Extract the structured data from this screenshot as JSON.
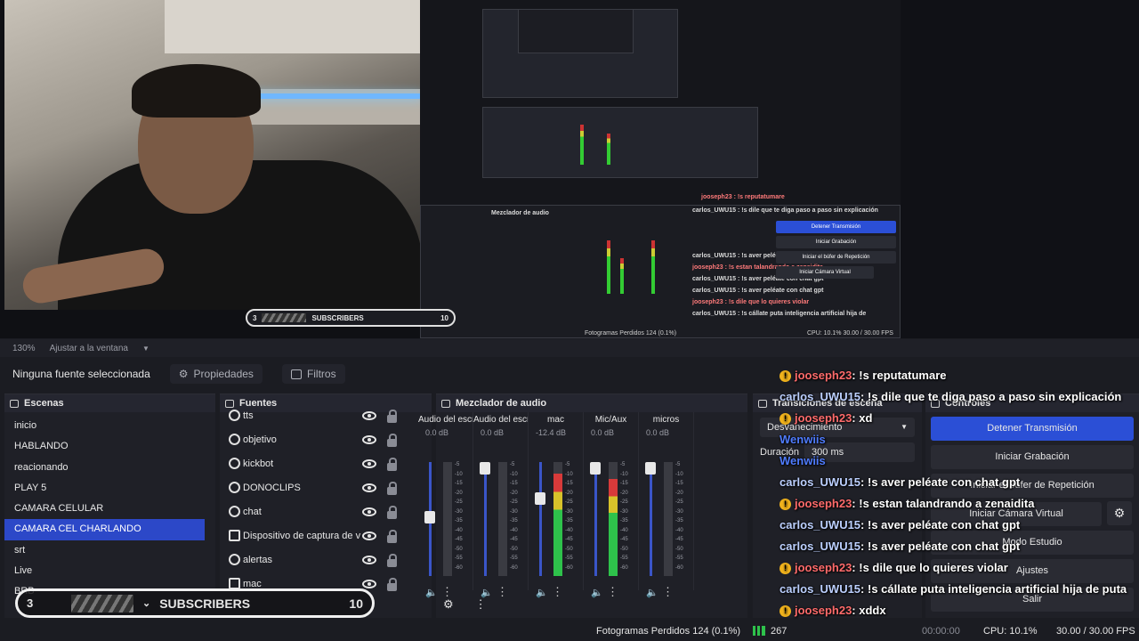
{
  "zoom": {
    "level": "130%",
    "fit_label": "Ajustar a la ventana"
  },
  "source_toolbar": {
    "no_source": "Ninguna fuente seleccionada",
    "properties": "Propiedades",
    "filters": "Filtros"
  },
  "scenes": {
    "title": "Escenas",
    "items": [
      "inicio",
      "HABLANDO",
      "reacionando",
      "PLAY 5",
      "CAMARA CELULAR",
      "CAMARA CEL CHARLANDO",
      "srt",
      "Live",
      "BRB"
    ],
    "selected": "CAMARA CEL CHARLANDO"
  },
  "sources": {
    "title": "Fuentes",
    "items": [
      {
        "name": "tts",
        "icon": "globe-icon"
      },
      {
        "name": "objetivo",
        "icon": "globe-icon"
      },
      {
        "name": "kickbot",
        "icon": "globe-icon"
      },
      {
        "name": "DONOCLIPS",
        "icon": "globe-icon"
      },
      {
        "name": "chat",
        "icon": "globe-icon"
      },
      {
        "name": "Dispositivo de captura de v",
        "icon": "camera-icon"
      },
      {
        "name": "alertas",
        "icon": "globe-icon"
      },
      {
        "name": "mac",
        "icon": "window-icon"
      }
    ]
  },
  "mixer": {
    "title": "Mezclador de audio",
    "channels": [
      {
        "label": "Audio del escritor",
        "db": "0.0 dB",
        "level": 0.0,
        "fader": 0.52
      },
      {
        "label": "Audio del escritor",
        "db": "0.0 dB",
        "level": 0.0,
        "fader": 1.0
      },
      {
        "label": "mac",
        "db": "-12.4 dB",
        "level": 0.9,
        "fader": 0.7
      },
      {
        "label": "Mic/Aux",
        "db": "0.0 dB",
        "level": 0.85,
        "fader": 1.0
      },
      {
        "label": "micros",
        "db": "0.0 dB",
        "level": 0.0,
        "fader": 1.0
      }
    ],
    "ticks": [
      "-5",
      "-10",
      "-15",
      "-20",
      "-25",
      "-30",
      "-35",
      "-40",
      "-45",
      "-50",
      "-55",
      "-60"
    ]
  },
  "transitions": {
    "title": "Transiciones de escena",
    "selected": "Desvanecimiento",
    "duration_label": "Duración",
    "duration_value": "300 ms"
  },
  "controls": {
    "title": "Controles",
    "buttons": [
      "Detener Transmisión",
      "Iniciar Grabación",
      "Iniciar el búfer de Repetición",
      "Iniciar Cámara Virtual",
      "Modo Estudio",
      "Ajustes",
      "Salir"
    ]
  },
  "chat": [
    {
      "user": "jooseph23",
      "msg": ": !s reputatumare",
      "badge": true
    },
    {
      "user": "carlos_UWU15",
      "msg": ": !s dile que te diga paso a paso sin explicación",
      "badge": false
    },
    {
      "user": "jooseph23",
      "msg": ": xd",
      "badge": true
    },
    {
      "user": "Wenwiis",
      "msg": "",
      "badge": false
    },
    {
      "user": "Wenwiis",
      "msg": "",
      "badge": false
    },
    {
      "user": "carlos_UWU15",
      "msg": ": !s aver peléate con chat gpt",
      "badge": false
    },
    {
      "user": "jooseph23",
      "msg": ": !s estan talandrando a zenaidita",
      "badge": true
    },
    {
      "user": "carlos_UWU15",
      "msg": ": !s aver peléate con chat gpt",
      "badge": false
    },
    {
      "user": "carlos_UWU15",
      "msg": ": !s aver peléate con chat gpt",
      "badge": false
    },
    {
      "user": "jooseph23",
      "msg": ": !s dile que lo quieres violar",
      "badge": true
    },
    {
      "user": "carlos_UWU15",
      "msg": ": !s cállate puta inteligencia artificial hija de puta",
      "badge": false,
      "wrap": true
    },
    {
      "user": "jooseph23",
      "msg": ": xddx",
      "badge": true
    }
  ],
  "subscribers": {
    "count": "3",
    "label": "SUBSCRIBERS",
    "goal": "10"
  },
  "status": {
    "dropped": "Fotogramas Perdidos 124 (0.1%)",
    "bitrate": "267",
    "rec_time": "00:00:00",
    "stream_time": "00:00:00",
    "cpu": "CPU: 10.1%",
    "fps": "30.00 / 30.00 FPS"
  },
  "colors": {
    "accent": "#2b4fd6",
    "scene_selected": "#2c48c8",
    "chat_mod": "#ff6b6b",
    "chat_user": "#bcd0ff"
  }
}
